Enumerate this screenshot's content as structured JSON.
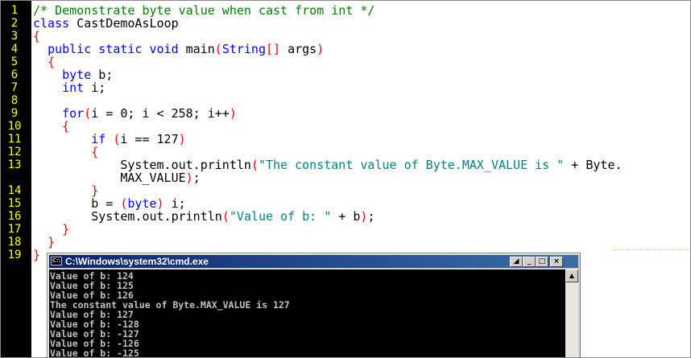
{
  "editor": {
    "line_numbers": [
      "1",
      "2",
      "3",
      "4",
      "5",
      "6",
      "7",
      "8",
      "9",
      "10",
      "11",
      "12",
      "13",
      "",
      "14",
      "15",
      "16",
      "17",
      "18",
      "19"
    ],
    "lines": [
      [
        {
          "t": "/* Demonstrate byte value when cast from int */",
          "c": "cmt"
        }
      ],
      [
        {
          "t": "class",
          "c": "kw"
        },
        {
          "t": " CastDemoAsLoop",
          "c": "txt"
        }
      ],
      [
        {
          "t": "{",
          "c": "br"
        }
      ],
      [
        {
          "t": "  ",
          "c": "txt"
        },
        {
          "t": "public static void",
          "c": "kw"
        },
        {
          "t": " main",
          "c": "txt"
        },
        {
          "t": "(",
          "c": "br"
        },
        {
          "t": "String",
          "c": "kw"
        },
        {
          "t": "[]",
          "c": "br"
        },
        {
          "t": " args",
          "c": "txt"
        },
        {
          "t": ")",
          "c": "br"
        }
      ],
      [
        {
          "t": "  ",
          "c": "txt"
        },
        {
          "t": "{",
          "c": "br"
        }
      ],
      [
        {
          "t": "    ",
          "c": "txt"
        },
        {
          "t": "byte",
          "c": "kw"
        },
        {
          "t": " b;",
          "c": "txt"
        }
      ],
      [
        {
          "t": "    ",
          "c": "txt"
        },
        {
          "t": "int",
          "c": "kw"
        },
        {
          "t": " i;",
          "c": "txt"
        }
      ],
      [],
      [
        {
          "t": "    ",
          "c": "txt"
        },
        {
          "t": "for",
          "c": "kw"
        },
        {
          "t": "(",
          "c": "br"
        },
        {
          "t": "i = 0; i < 258; i++",
          "c": "txt"
        },
        {
          "t": ")",
          "c": "br"
        }
      ],
      [
        {
          "t": "    ",
          "c": "txt"
        },
        {
          "t": "{",
          "c": "br"
        }
      ],
      [
        {
          "t": "        ",
          "c": "txt"
        },
        {
          "t": "if",
          "c": "kw"
        },
        {
          "t": " ",
          "c": "txt"
        },
        {
          "t": "(",
          "c": "br"
        },
        {
          "t": "i == 127",
          "c": "txt"
        },
        {
          "t": ")",
          "c": "br"
        }
      ],
      [
        {
          "t": "        ",
          "c": "txt"
        },
        {
          "t": "{",
          "c": "br"
        }
      ],
      [
        {
          "t": "            System.out.println",
          "c": "txt"
        },
        {
          "t": "(",
          "c": "br"
        },
        {
          "t": "\"The constant value of Byte.MAX_VALUE is \"",
          "c": "st"
        },
        {
          "t": " + Byte.",
          "c": "txt"
        }
      ],
      [
        {
          "t": "            MAX_VALUE",
          "c": "txt"
        },
        {
          "t": ")",
          "c": "br"
        },
        {
          "t": ";",
          "c": "txt"
        }
      ],
      [
        {
          "t": "        ",
          "c": "txt"
        },
        {
          "t": "}",
          "c": "br"
        }
      ],
      [
        {
          "t": "        b = ",
          "c": "txt"
        },
        {
          "t": "(",
          "c": "br"
        },
        {
          "t": "byte",
          "c": "kw"
        },
        {
          "t": ")",
          "c": "br"
        },
        {
          "t": " i;",
          "c": "txt"
        }
      ],
      [
        {
          "t": "        System.out.println",
          "c": "txt"
        },
        {
          "t": "(",
          "c": "br"
        },
        {
          "t": "\"Value of b: \"",
          "c": "st"
        },
        {
          "t": " + b",
          "c": "txt"
        },
        {
          "t": ")",
          "c": "br"
        },
        {
          "t": ";",
          "c": "txt"
        }
      ],
      [
        {
          "t": "    ",
          "c": "txt"
        },
        {
          "t": "}",
          "c": "br"
        }
      ],
      [
        {
          "t": "  ",
          "c": "txt"
        },
        {
          "t": "}",
          "c": "br"
        }
      ],
      [
        {
          "t": "}",
          "c": "br"
        }
      ]
    ]
  },
  "cmd_window": {
    "title": "C:\\Windows\\system32\\cmd.exe",
    "icon_label": "C:\\",
    "buttons": {
      "mark": "◢",
      "minimize": "_",
      "maximize": "□",
      "close": "×"
    },
    "scroll_up": "▲",
    "output_lines": [
      "Value of b: 124",
      "Value of b: 125",
      "Value of b: 126",
      "The constant value of Byte.MAX_VALUE is 127",
      "Value of b: 127",
      "Value of b: -128",
      "Value of b: -127",
      "Value of b: -126",
      "Value of b: -125"
    ]
  },
  "colors": {
    "gutter_bg": "#000000",
    "line_number": "#ffff00",
    "keyword": "#0000ff",
    "comment": "#008000",
    "string": "#008080",
    "bracket": "#ff0000",
    "title_bar_start": "#0a246a",
    "title_bar_end": "#3a6ea5"
  }
}
